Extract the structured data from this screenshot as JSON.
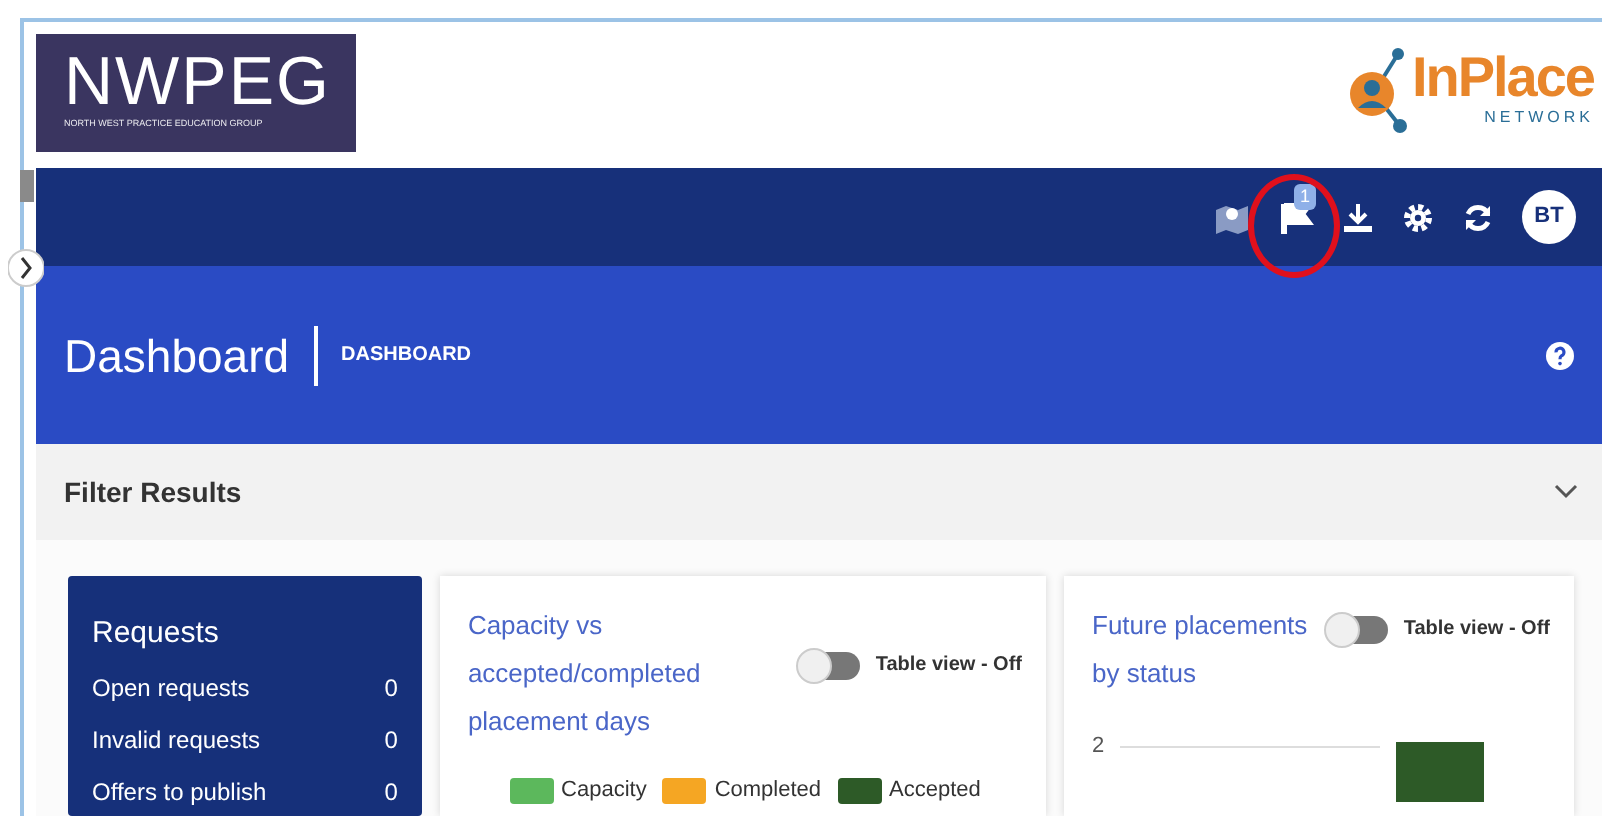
{
  "header": {
    "logo_title": "NWPEG",
    "logo_subtitle": "NORTH WEST PRACTICE EDUCATION GROUP",
    "brand": "InPlace",
    "brand_sub": "NETWORK"
  },
  "toolbar": {
    "notification_count": "1",
    "avatar": "BT"
  },
  "page": {
    "title": "Dashboard",
    "breadcrumb": "DASHBOARD"
  },
  "filter": {
    "title": "Filter Results",
    "expanded": false
  },
  "requests": {
    "title": "Requests",
    "rows": [
      {
        "label": "Open requests",
        "value": "0"
      },
      {
        "label": "Invalid requests",
        "value": "0"
      },
      {
        "label": "Offers to publish",
        "value": "0"
      }
    ]
  },
  "cards": [
    {
      "title": "Capacity vs accepted/completed placement days",
      "toggle_label": "Table view - Off",
      "on": false,
      "legend": [
        {
          "label": "Capacity",
          "color": "#5cb85c"
        },
        {
          "label": "Completed",
          "color": "#f5a623"
        },
        {
          "label": "Accepted",
          "color": "#2d5a27"
        }
      ]
    },
    {
      "title": "Future placements by status",
      "toggle_label": "Table view - Off",
      "on": false,
      "axis_label": "2"
    }
  ]
}
